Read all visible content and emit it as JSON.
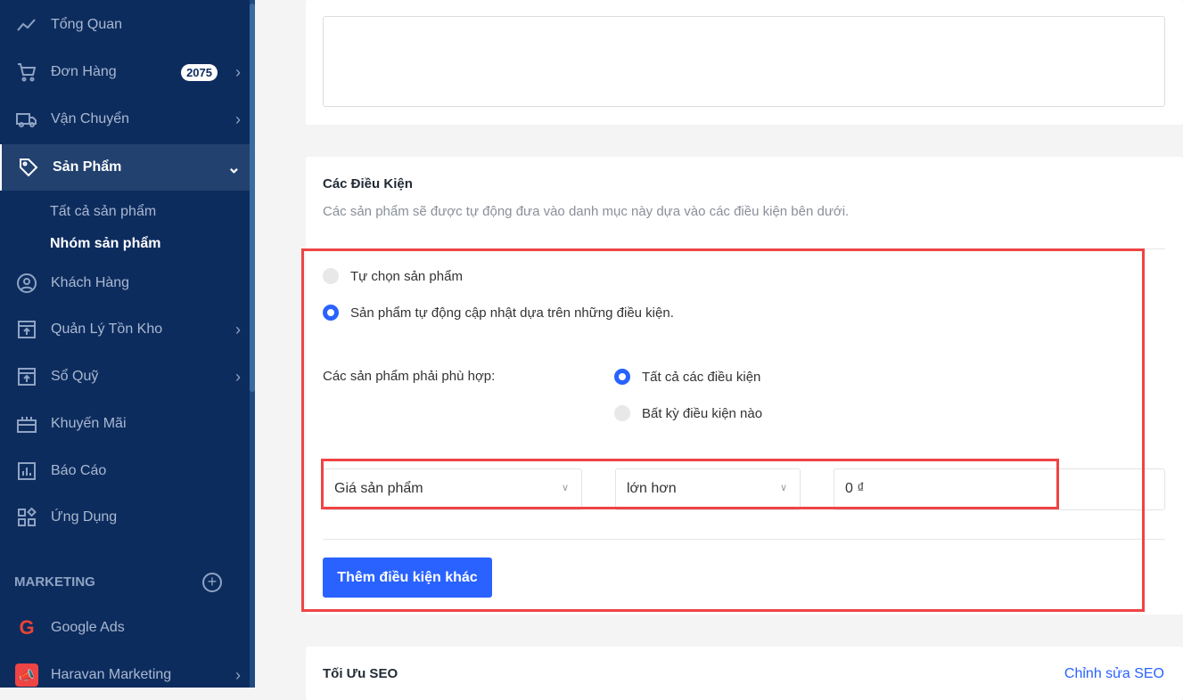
{
  "sidebar": {
    "items": [
      {
        "label": "Tổng Quan",
        "icon": "chart-line-icon"
      },
      {
        "label": "Đơn Hàng",
        "icon": "cart-icon",
        "badge": "2075"
      },
      {
        "label": "Vận Chuyển",
        "icon": "truck-icon"
      },
      {
        "label": "Sản Phẩm",
        "icon": "tag-icon"
      },
      {
        "label": "Khách Hàng",
        "icon": "user-circle-icon"
      },
      {
        "label": "Quản Lý Tồn Kho",
        "icon": "inventory-icon"
      },
      {
        "label": "Sổ Quỹ",
        "icon": "cashbook-icon"
      },
      {
        "label": "Khuyến Mãi",
        "icon": "gift-icon"
      },
      {
        "label": "Báo Cáo",
        "icon": "report-icon"
      },
      {
        "label": "Ứng Dụng",
        "icon": "apps-icon"
      }
    ],
    "sub_items": [
      "Tất cả sản phẩm",
      "Nhóm sản phẩm"
    ],
    "marketing_heading": "MARKETING",
    "marketing_items": [
      {
        "label": "Google Ads"
      },
      {
        "label": "Haravan Marketing"
      }
    ]
  },
  "conditions": {
    "title": "Các Điều Kiện",
    "description": "Các sản phẩm sẽ được tự động đưa vào danh mục này dựa vào các điều kiện bên dưới.",
    "mode_options": [
      "Tự chọn sản phẩm",
      "Sản phẩm tự động cập nhật dựa trên những điều kiện."
    ],
    "match_label": "Các sản phẩm phải phù hợp:",
    "match_options": [
      "Tất cả các điều kiện",
      "Bất kỳ điều kiện nào"
    ],
    "field": "Giá sản phẩm",
    "operator": "lớn hơn",
    "value": "0 ₫",
    "add_button": "Thêm điều kiện khác"
  },
  "seo": {
    "title": "Tối Ưu SEO",
    "edit_link": "Chỉnh sửa SEO"
  },
  "colors": {
    "sidebar": "#0d2c5e",
    "accent": "#2962ff",
    "highlight": "#ef4444"
  }
}
